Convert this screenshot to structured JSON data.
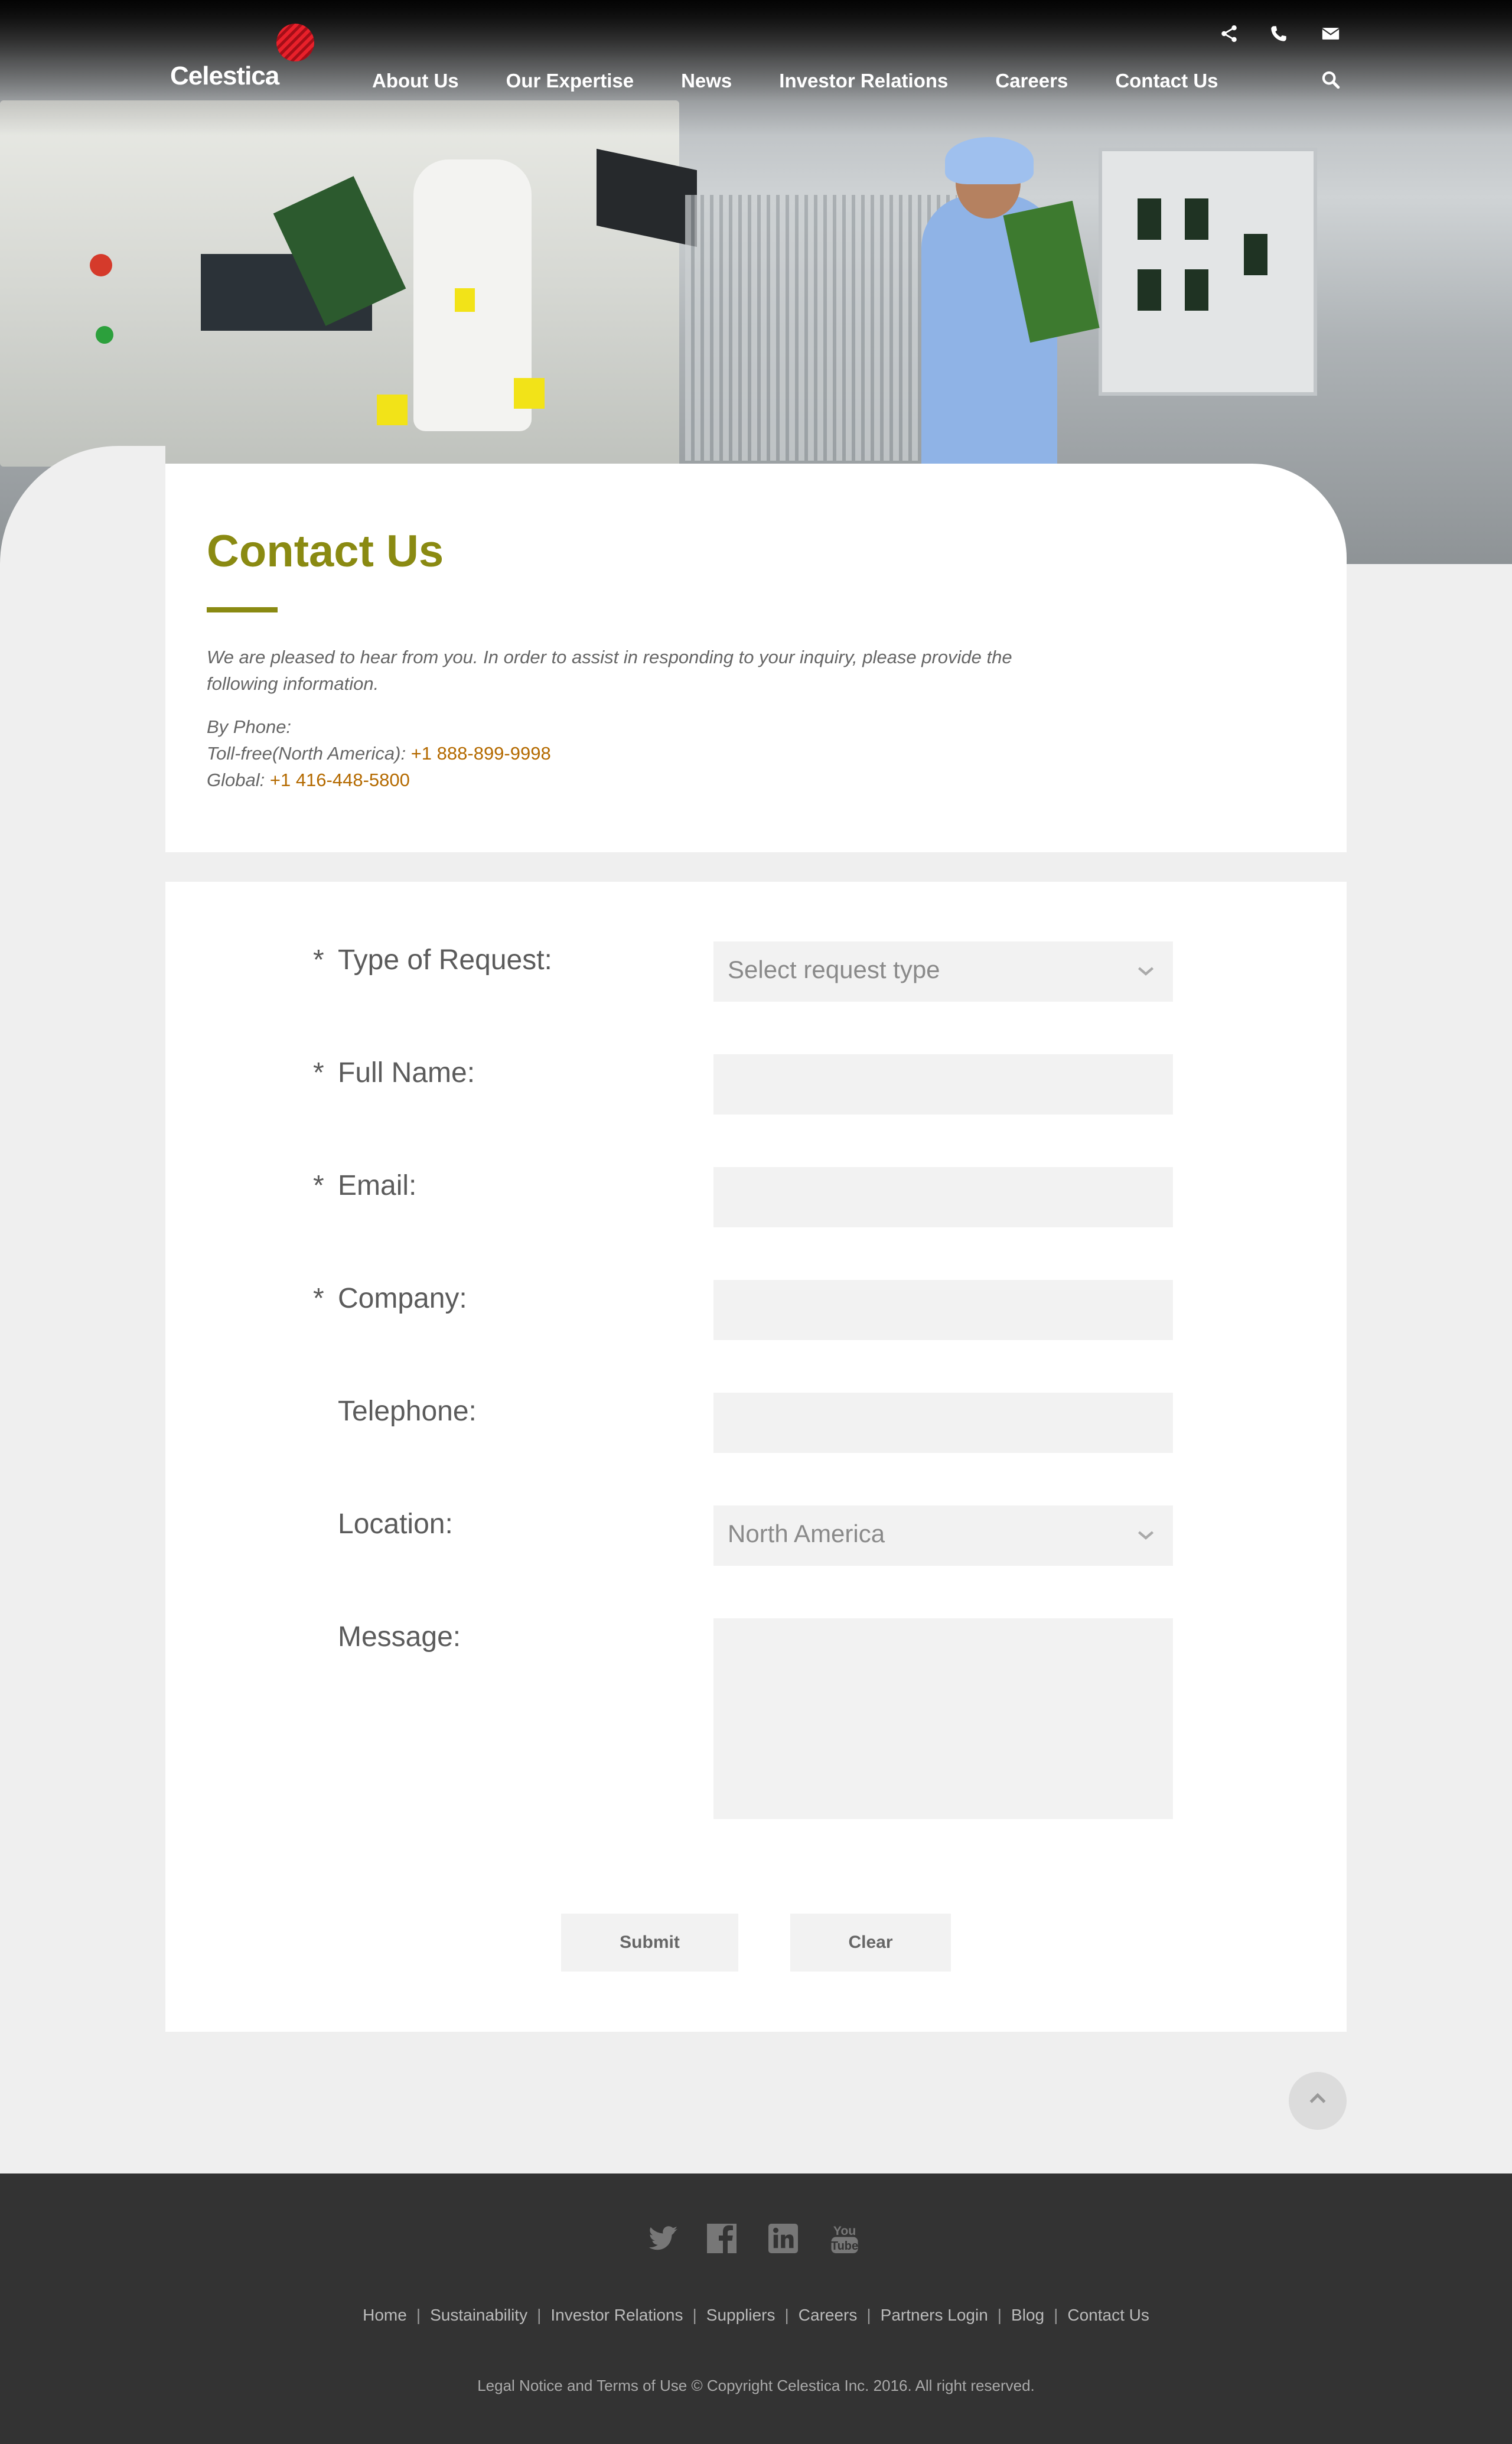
{
  "header": {
    "logo": "Celestica",
    "nav": [
      "About Us",
      "Our Expertise",
      "News",
      "Investor Relations",
      "Careers",
      "Contact Us"
    ],
    "icons": [
      "share-icon",
      "phone-icon",
      "envelope-icon",
      "search-icon"
    ]
  },
  "contact": {
    "title": "Contact Us",
    "intro": "We are pleased to hear from you. In order to assist in responding to your inquiry, please provide the following information.",
    "by_phone_label": "By Phone:",
    "tollfree_label": "Toll-free(North America):",
    "tollfree_number": "+1 888-899-9998",
    "global_label": "Global:",
    "global_number": "+1 416-448-5800"
  },
  "form": {
    "request_type": {
      "label": "Type of Request:",
      "required": "*",
      "value": "Select request type"
    },
    "full_name": {
      "label": "Full Name:",
      "required": "*",
      "value": ""
    },
    "email": {
      "label": "Email:",
      "required": "*",
      "value": ""
    },
    "company": {
      "label": "Company:",
      "required": "*",
      "value": ""
    },
    "telephone": {
      "label": "Telephone:",
      "value": ""
    },
    "location": {
      "label": "Location:",
      "value": "North America"
    },
    "message": {
      "label": "Message:",
      "value": ""
    },
    "submit": "Submit",
    "clear": "Clear"
  },
  "footer": {
    "social": [
      "twitter-icon",
      "facebook-icon",
      "linkedin-icon",
      "youtube-icon"
    ],
    "links": [
      "Home",
      "Sustainability",
      "Investor Relations",
      "Suppliers",
      "Careers",
      "Partners Login",
      "Blog",
      "Contact Us"
    ],
    "separator": "|",
    "legal": "Legal Notice and Terms of Use © Copyright Celestica Inc. 2016. All right reserved."
  },
  "colors": {
    "accent_olive": "#8a8a12",
    "link_orange": "#b46a00",
    "footer_bg": "#333333"
  }
}
